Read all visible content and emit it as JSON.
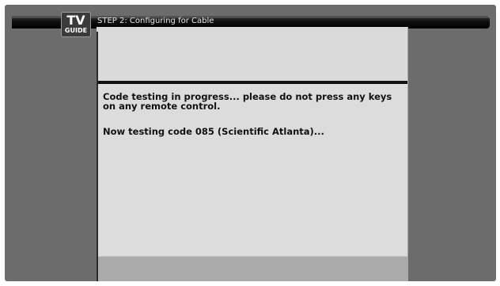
{
  "header": {
    "logo": {
      "line1": "TV",
      "line2": "GUIDE"
    },
    "title": "STEP 2: Configuring for Cable"
  },
  "content": {
    "message": "Code testing in progress... please do not press any keys on any remote control.",
    "status": "Now testing code 085 (Scientific Atlanta)..."
  },
  "colors": {
    "screen_background": "#6c6c6c",
    "panel_background": "#dcdcdc",
    "footer_background": "#aaaaaa",
    "header_bar": "#000000",
    "text": "#111111"
  }
}
